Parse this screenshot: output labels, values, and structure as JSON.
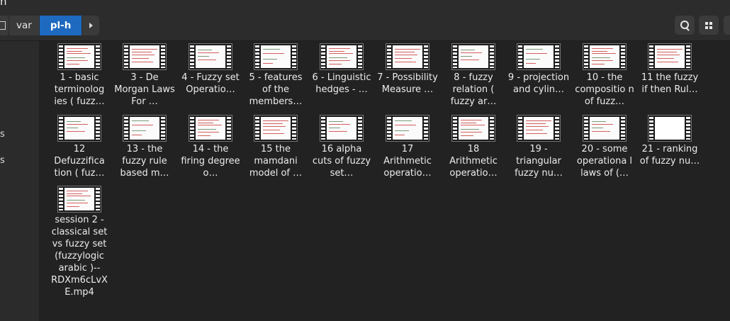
{
  "window": {
    "title": "n"
  },
  "pathbar": {
    "segments": [
      "var",
      "pl-h"
    ],
    "active": "pl-h"
  },
  "sidebar": {
    "items": [
      "s",
      "s"
    ]
  },
  "files": [
    {
      "name": "1 - basic terminolog ies ( fuzz…",
      "thumb": "sketch"
    },
    {
      "name": "3 - De Morgan Laws For …",
      "thumb": "sketch"
    },
    {
      "name": "4 - Fuzzy set Operatio…",
      "thumb": "sketch"
    },
    {
      "name": "5 - features of the members…",
      "thumb": "sketch"
    },
    {
      "name": "6 - Linguistic hedges - …",
      "thumb": "sketch"
    },
    {
      "name": "7 - Possibility Measure …",
      "thumb": "sketch"
    },
    {
      "name": "8 - fuzzy relation ( fuzzy ar…",
      "thumb": "sketch"
    },
    {
      "name": "9 - projection and cylin…",
      "thumb": "sketch"
    },
    {
      "name": "10 - the compositio n of fuzz…",
      "thumb": "sketch"
    },
    {
      "name": "11 the fuzzy if then Rul…",
      "thumb": "sketch"
    },
    {
      "name": "12 Defuzzifica tion ( fuz…",
      "thumb": "sketch"
    },
    {
      "name": "13 - the fuzzy rule based m…",
      "thumb": "sketch"
    },
    {
      "name": "14 - the firing degree o…",
      "thumb": "sketch"
    },
    {
      "name": "15 the mamdani model of …",
      "thumb": "sketch"
    },
    {
      "name": "16 alpha cuts of fuzzy set…",
      "thumb": "sketch"
    },
    {
      "name": "17 Arithmetic operatio…",
      "thumb": "sketch"
    },
    {
      "name": "18 Arithmetic operatio…",
      "thumb": "sketch"
    },
    {
      "name": "19 - triangular fuzzy nu…",
      "thumb": "sketch"
    },
    {
      "name": "20 - some operationa l laws of (…",
      "thumb": "sketch"
    },
    {
      "name": "21 - ranking of fuzzy nu…",
      "thumb": "blank"
    },
    {
      "name": "session 2 - classical set vs fuzzy set (fuzzylogic arabic )--RDXm6cLvXE.mp4",
      "thumb": "sketch"
    }
  ],
  "colors": {
    "accent": "#1d6ac0",
    "background": "#222222",
    "header": "#2c2c2c",
    "sidebar": "#2b2b2b"
  },
  "icons": {
    "search": "search-icon",
    "view": "grid-view-icon",
    "arrow": "path-forward-icon",
    "drive": "drive-icon",
    "video": "video-file-icon"
  }
}
